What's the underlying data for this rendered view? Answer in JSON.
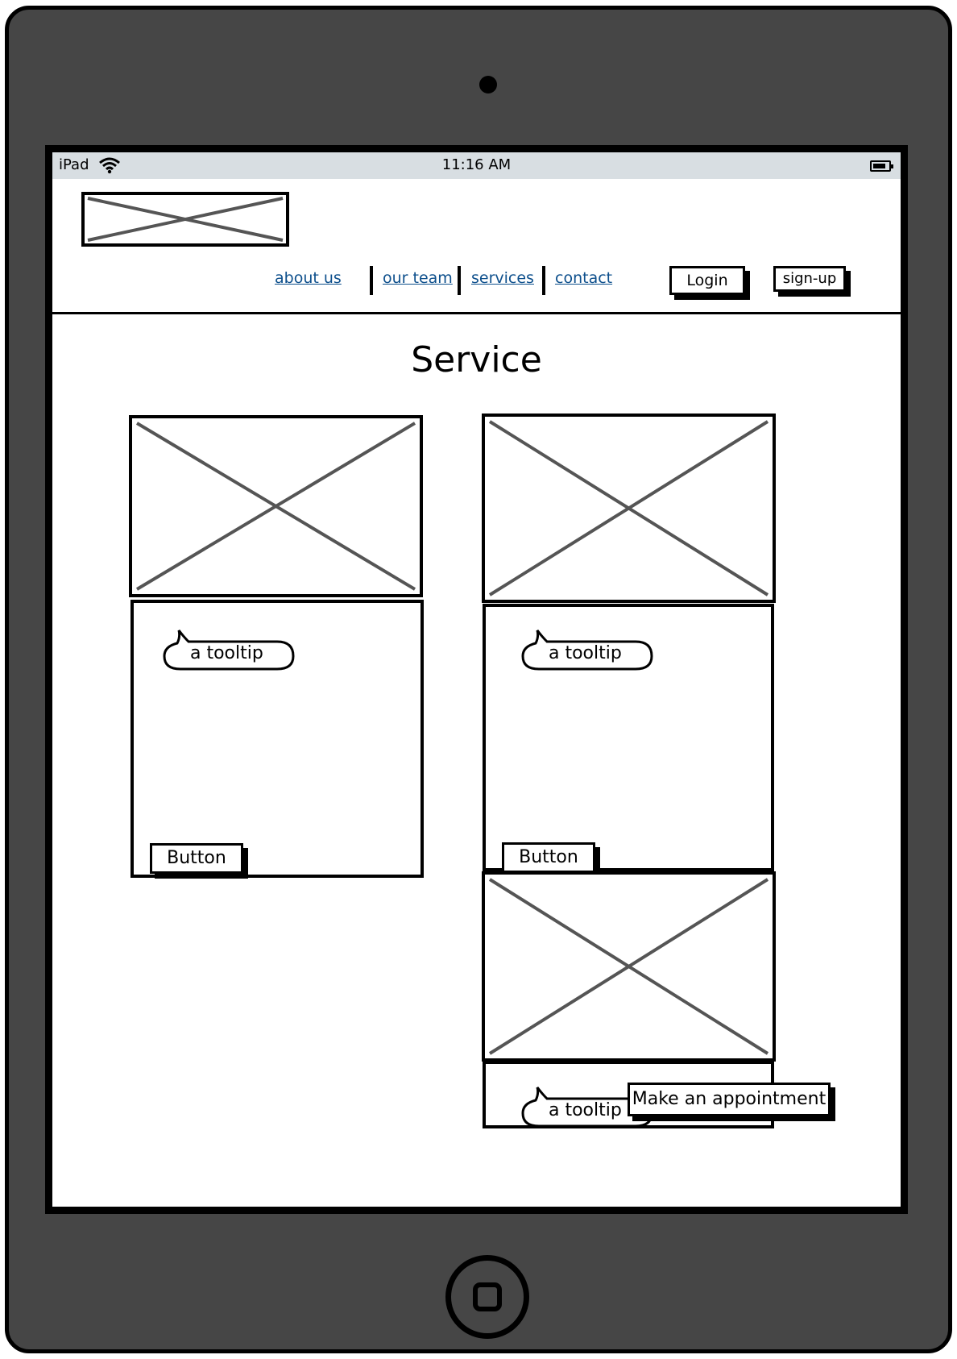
{
  "status_bar": {
    "device": "iPad",
    "time": "11:16 AM"
  },
  "nav": {
    "links": [
      "about us",
      "our team",
      "services",
      "contact"
    ],
    "login": "Login",
    "signup": "sign-up"
  },
  "page": {
    "title": "Service"
  },
  "cards": [
    {
      "tooltip": "a tooltip",
      "button": "Button"
    },
    {
      "tooltip": "a tooltip",
      "button": "Button"
    },
    {
      "tooltip": "a tooltip",
      "button": "Make an appointment"
    }
  ],
  "colors": {
    "frame": "#464646",
    "status_bar": "#d8dee2",
    "link": "#0d4f8c",
    "placeholder_cross": "#555555"
  }
}
